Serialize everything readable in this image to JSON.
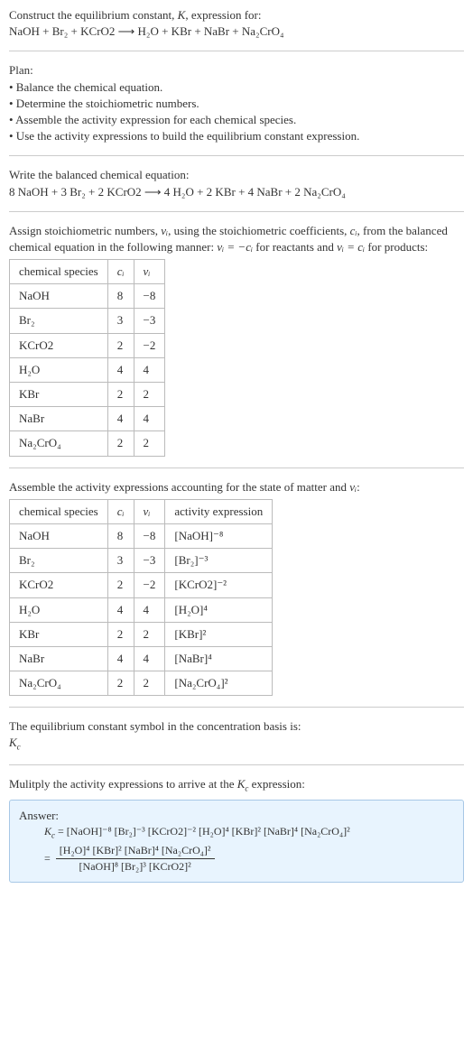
{
  "header": {
    "line1": "Construct the equilibrium constant, K, expression for:",
    "eq": "NaOH + Br₂ + KCrO2 ⟶ H₂O + KBr + NaBr + Na₂CrO₄"
  },
  "plan": {
    "title": "Plan:",
    "b1": "• Balance the chemical equation.",
    "b2": "• Determine the stoichiometric numbers.",
    "b3": "• Assemble the activity expression for each chemical species.",
    "b4": "• Use the activity expressions to build the equilibrium constant expression."
  },
  "balanced": {
    "title": "Write the balanced chemical equation:",
    "eq": "8 NaOH + 3 Br₂ + 2 KCrO2 ⟶ 4 H₂O + 2 KBr + 4 NaBr + 2 Na₂CrO₄"
  },
  "assign": {
    "p1a": "Assign stoichiometric numbers, ",
    "p1b": ", using the stoichiometric coefficients, ",
    "p1c": ", from the balanced chemical equation in the following manner: ",
    "p1d": " for reactants and ",
    "p1e": " for products:",
    "nu": "νᵢ",
    "ci": "cᵢ",
    "rel_react": "νᵢ = −cᵢ",
    "rel_prod": "νᵢ = cᵢ"
  },
  "table1": {
    "h1": "chemical species",
    "h2": "cᵢ",
    "h3": "νᵢ",
    "rows": [
      {
        "s": "NaOH",
        "c": "8",
        "v": "−8"
      },
      {
        "s": "Br₂",
        "c": "3",
        "v": "−3"
      },
      {
        "s": "KCrO2",
        "c": "2",
        "v": "−2"
      },
      {
        "s": "H₂O",
        "c": "4",
        "v": "4"
      },
      {
        "s": "KBr",
        "c": "2",
        "v": "2"
      },
      {
        "s": "NaBr",
        "c": "4",
        "v": "4"
      },
      {
        "s": "Na₂CrO₄",
        "c": "2",
        "v": "2"
      }
    ]
  },
  "assemble": {
    "p_a": "Assemble the activity expressions accounting for the state of matter and ",
    "p_b": ":"
  },
  "table2": {
    "h1": "chemical species",
    "h2": "cᵢ",
    "h3": "νᵢ",
    "h4": "activity expression",
    "rows": [
      {
        "s": "NaOH",
        "c": "8",
        "v": "−8",
        "a": "[NaOH]⁻⁸"
      },
      {
        "s": "Br₂",
        "c": "3",
        "v": "−3",
        "a": "[Br₂]⁻³"
      },
      {
        "s": "KCrO2",
        "c": "2",
        "v": "−2",
        "a": "[KCrO2]⁻²"
      },
      {
        "s": "H₂O",
        "c": "4",
        "v": "4",
        "a": "[H₂O]⁴"
      },
      {
        "s": "KBr",
        "c": "2",
        "v": "2",
        "a": "[KBr]²"
      },
      {
        "s": "NaBr",
        "c": "4",
        "v": "4",
        "a": "[NaBr]⁴"
      },
      {
        "s": "Na₂CrO₄",
        "c": "2",
        "v": "2",
        "a": "[Na₂CrO₄]²"
      }
    ]
  },
  "Kc_symbol": {
    "text": "The equilibrium constant symbol in the concentration basis is:",
    "sym": "K_c"
  },
  "mult": {
    "p_a": "Mulitply the activity expressions to arrive at the ",
    "p_b": " expression:",
    "kc": "K_c"
  },
  "answer": {
    "label": "Answer:",
    "lhs": "K_c = ",
    "line1": "[NaOH]⁻⁸ [Br₂]⁻³ [KCrO2]⁻² [H₂O]⁴ [KBr]² [NaBr]⁴ [Na₂CrO₄]²",
    "eq2": " = ",
    "num": "[H₂O]⁴ [KBr]² [NaBr]⁴ [Na₂CrO₄]²",
    "den": "[NaOH]⁸ [Br₂]³ [KCrO2]²"
  }
}
